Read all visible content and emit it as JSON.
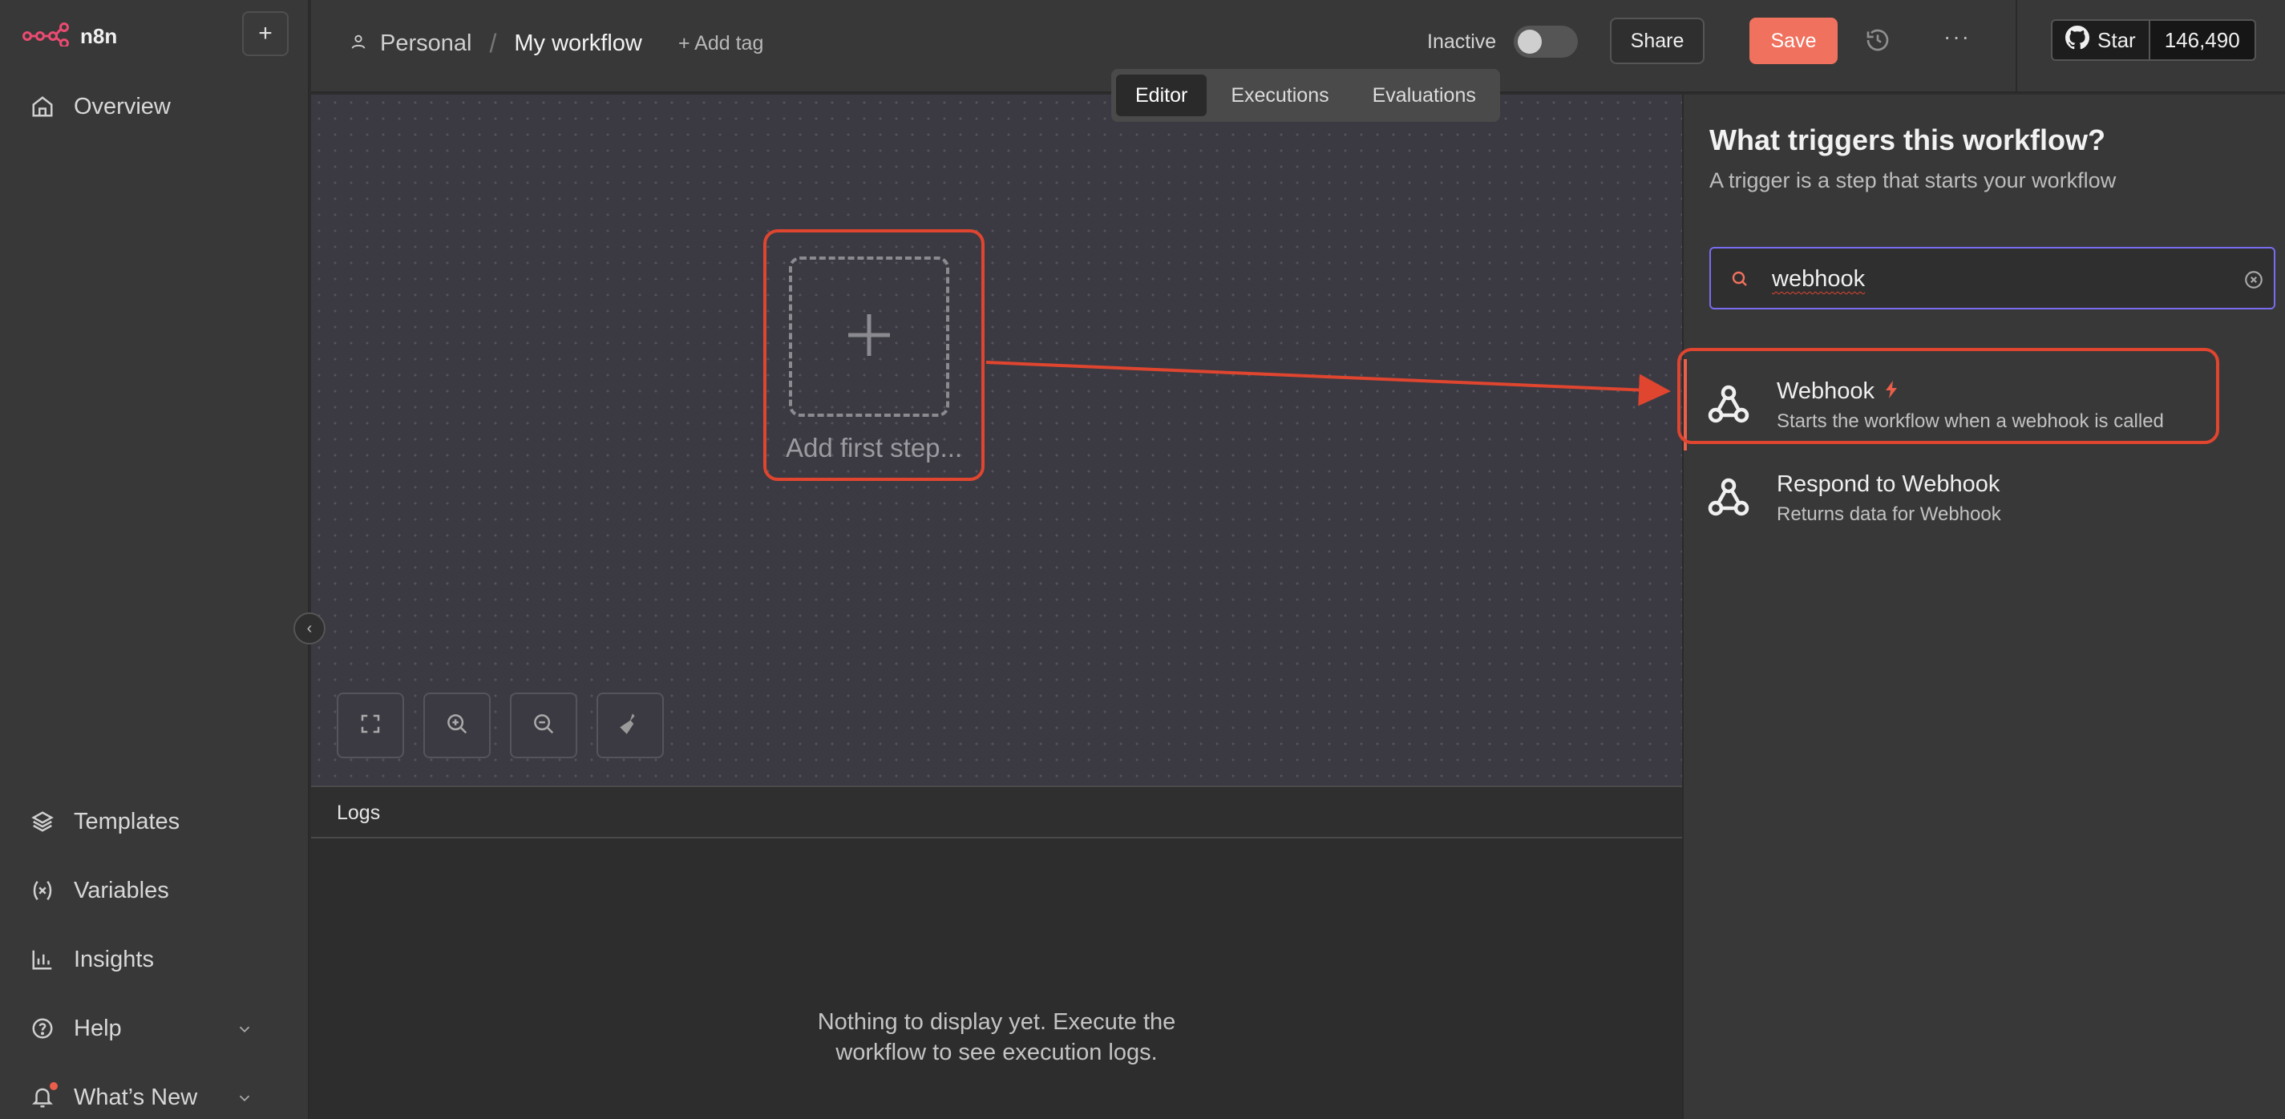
{
  "app": {
    "logo_text": "n8n"
  },
  "sidebar": {
    "items": [
      {
        "label": "Overview",
        "icon": "home-icon"
      },
      {
        "label": "Templates",
        "icon": "templates-icon"
      },
      {
        "label": "Variables",
        "icon": "variables-icon"
      },
      {
        "label": "Insights",
        "icon": "insights-icon"
      },
      {
        "label": "Help",
        "icon": "help-icon"
      },
      {
        "label": "What’s New",
        "icon": "bell-icon"
      }
    ]
  },
  "header": {
    "project": "Personal",
    "workflow_name": "My workflow",
    "add_tag": "+ Add tag",
    "status_label": "Inactive",
    "share_label": "Share",
    "save_label": "Save",
    "github_star_label": "Star",
    "github_star_count": "146,490"
  },
  "tabs": [
    {
      "label": "Editor",
      "active": true
    },
    {
      "label": "Executions",
      "active": false
    },
    {
      "label": "Evaluations",
      "active": false
    }
  ],
  "canvas": {
    "add_first_step": "Add first step..."
  },
  "logs": {
    "title": "Logs",
    "empty_line1": "Nothing to display yet. Execute the",
    "empty_line2": "workflow to see execution logs."
  },
  "panel": {
    "title": "What triggers this workflow?",
    "subtitle": "A trigger is a step that starts your workflow",
    "search_value": "webhook",
    "results": [
      {
        "name": "Webhook",
        "description": "Starts the workflow when a webhook is called",
        "trigger_badge": true
      },
      {
        "name": "Respond to Webhook",
        "description": "Returns data for Webhook",
        "trigger_badge": false
      }
    ]
  },
  "colors": {
    "accent": "#f0715d",
    "highlight": "#e0452f",
    "focus": "#7a6cf0"
  }
}
